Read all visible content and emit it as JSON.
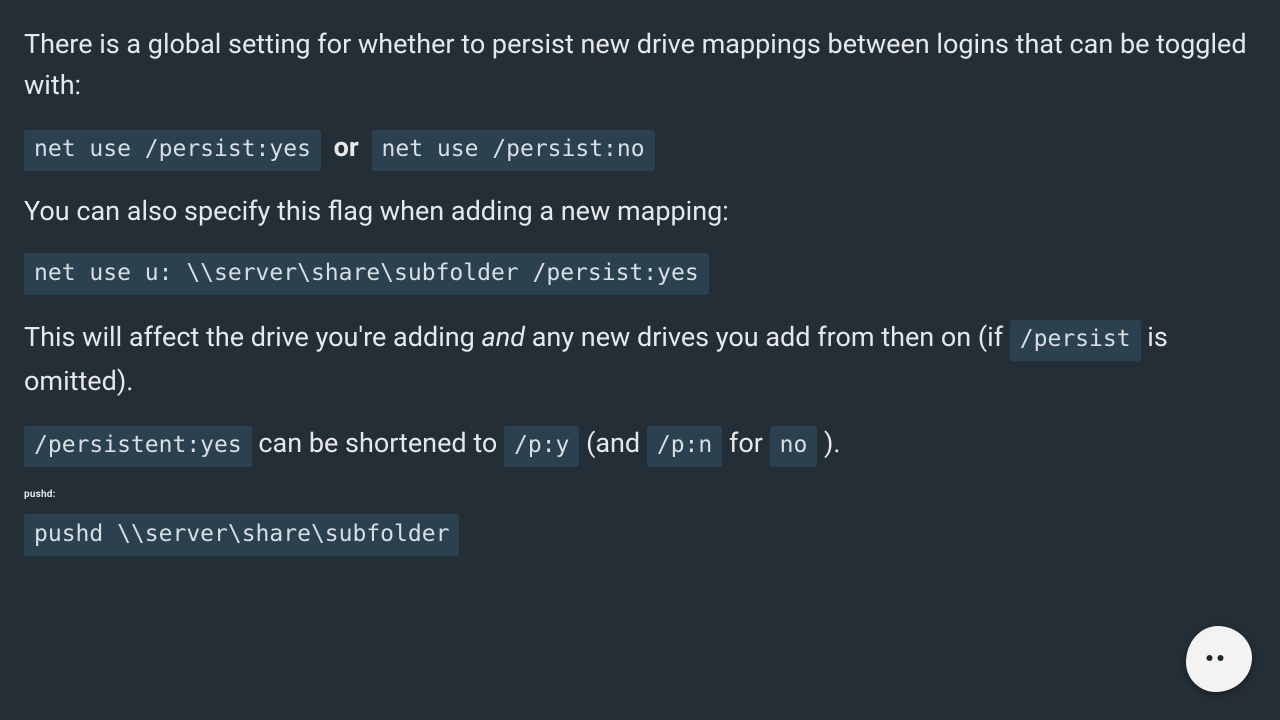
{
  "p1": {
    "text": "There is a global setting for whether to persist new drive mappings between logins that can be toggled with:"
  },
  "line1": {
    "code_yes": "net use /persist:yes",
    "or": "or",
    "code_no": "net use /persist:no"
  },
  "p2": {
    "text": "You can also specify this flag when adding a new mapping:"
  },
  "block1": {
    "code": "net use u: \\\\server\\share\\subfolder /persist:yes"
  },
  "p3": {
    "pre": "This will affect the drive you're adding ",
    "and": "and",
    "mid": " any new drives you add from then on (if ",
    "code_persist": "/persist",
    "post": " is omitted)."
  },
  "p4": {
    "code_full": "/persistent:yes",
    "mid1": " can be shortened to ",
    "code_py": "/p:y",
    "mid2": " (and ",
    "code_pn": "/p:n",
    "mid3": " for ",
    "code_no": "no",
    "post": " )."
  },
  "heading_pushd": "pushd:",
  "block2": {
    "code": "pushd \\\\server\\share\\subfolder"
  }
}
